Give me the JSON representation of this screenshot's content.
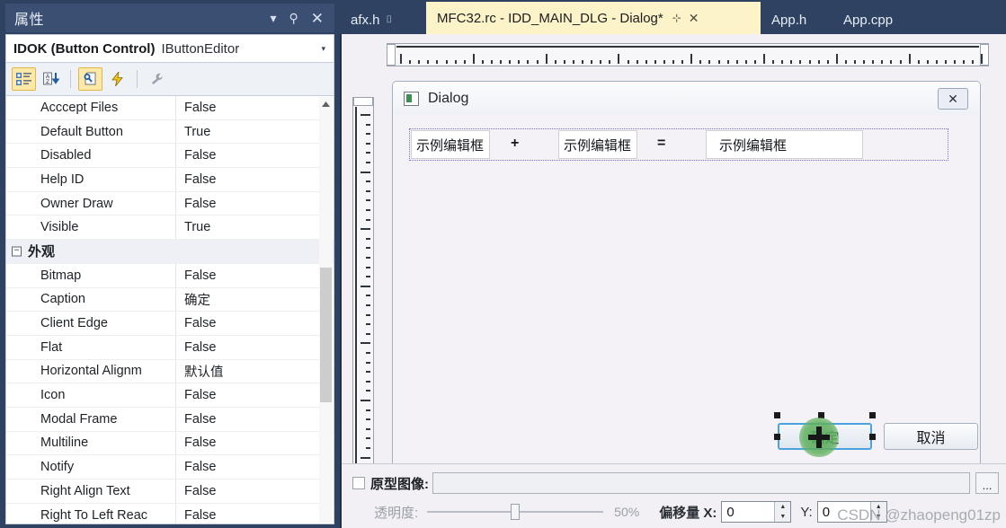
{
  "properties_panel": {
    "title": "属性",
    "titlebar_icons": [
      "dropdown-icon",
      "pin-icon",
      "close-icon"
    ],
    "object_name": "IDOK (Button Control)",
    "object_editor": "IButtonEditor",
    "toolbar": [
      {
        "name": "categorized-view-icon",
        "active": true
      },
      {
        "name": "alphabetical-sort-icon",
        "active": false
      },
      {
        "name": "property-pages-icon",
        "active": true
      },
      {
        "name": "events-icon",
        "active": false
      },
      {
        "name": "wrench-icon",
        "active": false
      }
    ],
    "rows": [
      {
        "name": "Acccept Files",
        "value": "False",
        "category": false
      },
      {
        "name": "Default Button",
        "value": "True",
        "category": false
      },
      {
        "name": "Disabled",
        "value": "False",
        "category": false
      },
      {
        "name": "Help ID",
        "value": "False",
        "category": false
      },
      {
        "name": "Owner Draw",
        "value": "False",
        "category": false
      },
      {
        "name": "Visible",
        "value": "True",
        "category": false
      },
      {
        "name": "外观",
        "value": "",
        "category": true
      },
      {
        "name": "Bitmap",
        "value": "False",
        "category": false
      },
      {
        "name": "Caption",
        "value": "确定",
        "category": false
      },
      {
        "name": "Client Edge",
        "value": "False",
        "category": false
      },
      {
        "name": "Flat",
        "value": "False",
        "category": false
      },
      {
        "name": "Horizontal Alignm",
        "value": "默认值",
        "category": false
      },
      {
        "name": "Icon",
        "value": "False",
        "category": false
      },
      {
        "name": "Modal Frame",
        "value": "False",
        "category": false
      },
      {
        "name": "Multiline",
        "value": "False",
        "category": false
      },
      {
        "name": "Notify",
        "value": "False",
        "category": false
      },
      {
        "name": "Right Align Text",
        "value": "False",
        "category": false
      },
      {
        "name": "Right To Left Reac",
        "value": "False",
        "category": false
      }
    ],
    "expander_glyph": "−"
  },
  "tabs": [
    {
      "label": "afx.h",
      "active": false,
      "lock": "🔒",
      "pin": false,
      "close": false
    },
    {
      "label": "MFC32.rc - IDD_MAIN_DLG - Dialog*",
      "active": true,
      "lock": "",
      "pin": true,
      "close": true
    },
    {
      "label": "App.h",
      "active": false,
      "lock": "",
      "pin": false,
      "close": false
    },
    {
      "label": "App.cpp",
      "active": false,
      "lock": "",
      "pin": false,
      "close": false
    }
  ],
  "tab_icons": {
    "pin": "⊹",
    "close": "✕"
  },
  "dialog": {
    "title": "Dialog",
    "close_label": "✕",
    "icon_name": "dialog-app-icon",
    "edit_boxes": [
      {
        "text": "示例编辑框"
      },
      {
        "text": "示例编辑框"
      },
      {
        "text": "示例编辑框"
      }
    ],
    "operators": [
      "+",
      "="
    ],
    "buttons": [
      {
        "label": "确定",
        "selected": true
      },
      {
        "label": "取消",
        "selected": false
      }
    ]
  },
  "prototype_panel": {
    "checkbox_label": "原型图像:",
    "checked": false,
    "path_value": "",
    "browse_label": "...",
    "opacity_label": "透明度:",
    "opacity_percent": "50%",
    "opacity_value": 50,
    "offset_label": "偏移量 X:",
    "offset_x": "0",
    "offset_y_label": "Y:",
    "offset_y": "0",
    "spinner_up": "▲",
    "spinner_down": "▼"
  },
  "watermark": "CSDN @zhaopeng01zp",
  "colors": {
    "shell_blue": "#2f4262",
    "active_tab": "#fdf3c9",
    "doc_bg": "#f2f0f4",
    "selection_blue": "#4aa3df",
    "cursor_green": "#56a856"
  }
}
